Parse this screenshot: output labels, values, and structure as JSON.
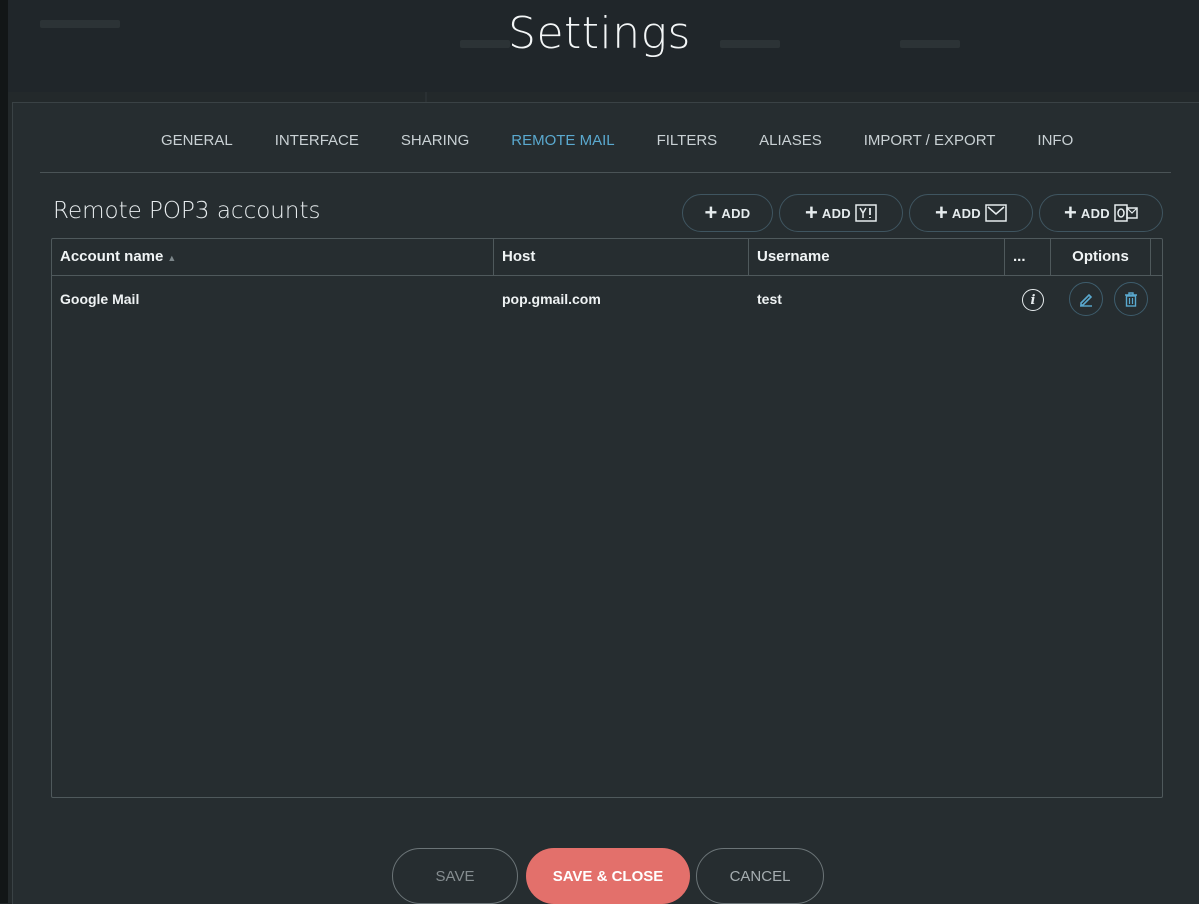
{
  "modal": {
    "title": "Settings",
    "tabs": [
      {
        "label": "GENERAL",
        "active": false
      },
      {
        "label": "INTERFACE",
        "active": false
      },
      {
        "label": "SHARING",
        "active": false
      },
      {
        "label": "REMOTE MAIL",
        "active": true
      },
      {
        "label": "FILTERS",
        "active": false
      },
      {
        "label": "ALIASES",
        "active": false
      },
      {
        "label": "IMPORT / EXPORT",
        "active": false
      },
      {
        "label": "INFO",
        "active": false
      }
    ],
    "accent_color": "#5aa9cf"
  },
  "remote": {
    "section_title": "Remote POP3 accounts",
    "add_buttons": [
      {
        "label": "ADD",
        "provider_icon": null
      },
      {
        "label": "ADD",
        "provider_icon": "yahoo-icon"
      },
      {
        "label": "ADD",
        "provider_icon": "gmail-icon"
      },
      {
        "label": "ADD",
        "provider_icon": "outlook-icon"
      }
    ],
    "table": {
      "columns": [
        "Account name",
        "Host",
        "Username",
        "...",
        "Options"
      ],
      "rows": [
        {
          "account_name": "Google Mail",
          "host": "pop.gmail.com",
          "username": "test"
        }
      ]
    }
  },
  "footer": {
    "save": "SAVE",
    "save_close": "SAVE & CLOSE",
    "cancel": "CANCEL",
    "primary_color": "#e3706b"
  }
}
